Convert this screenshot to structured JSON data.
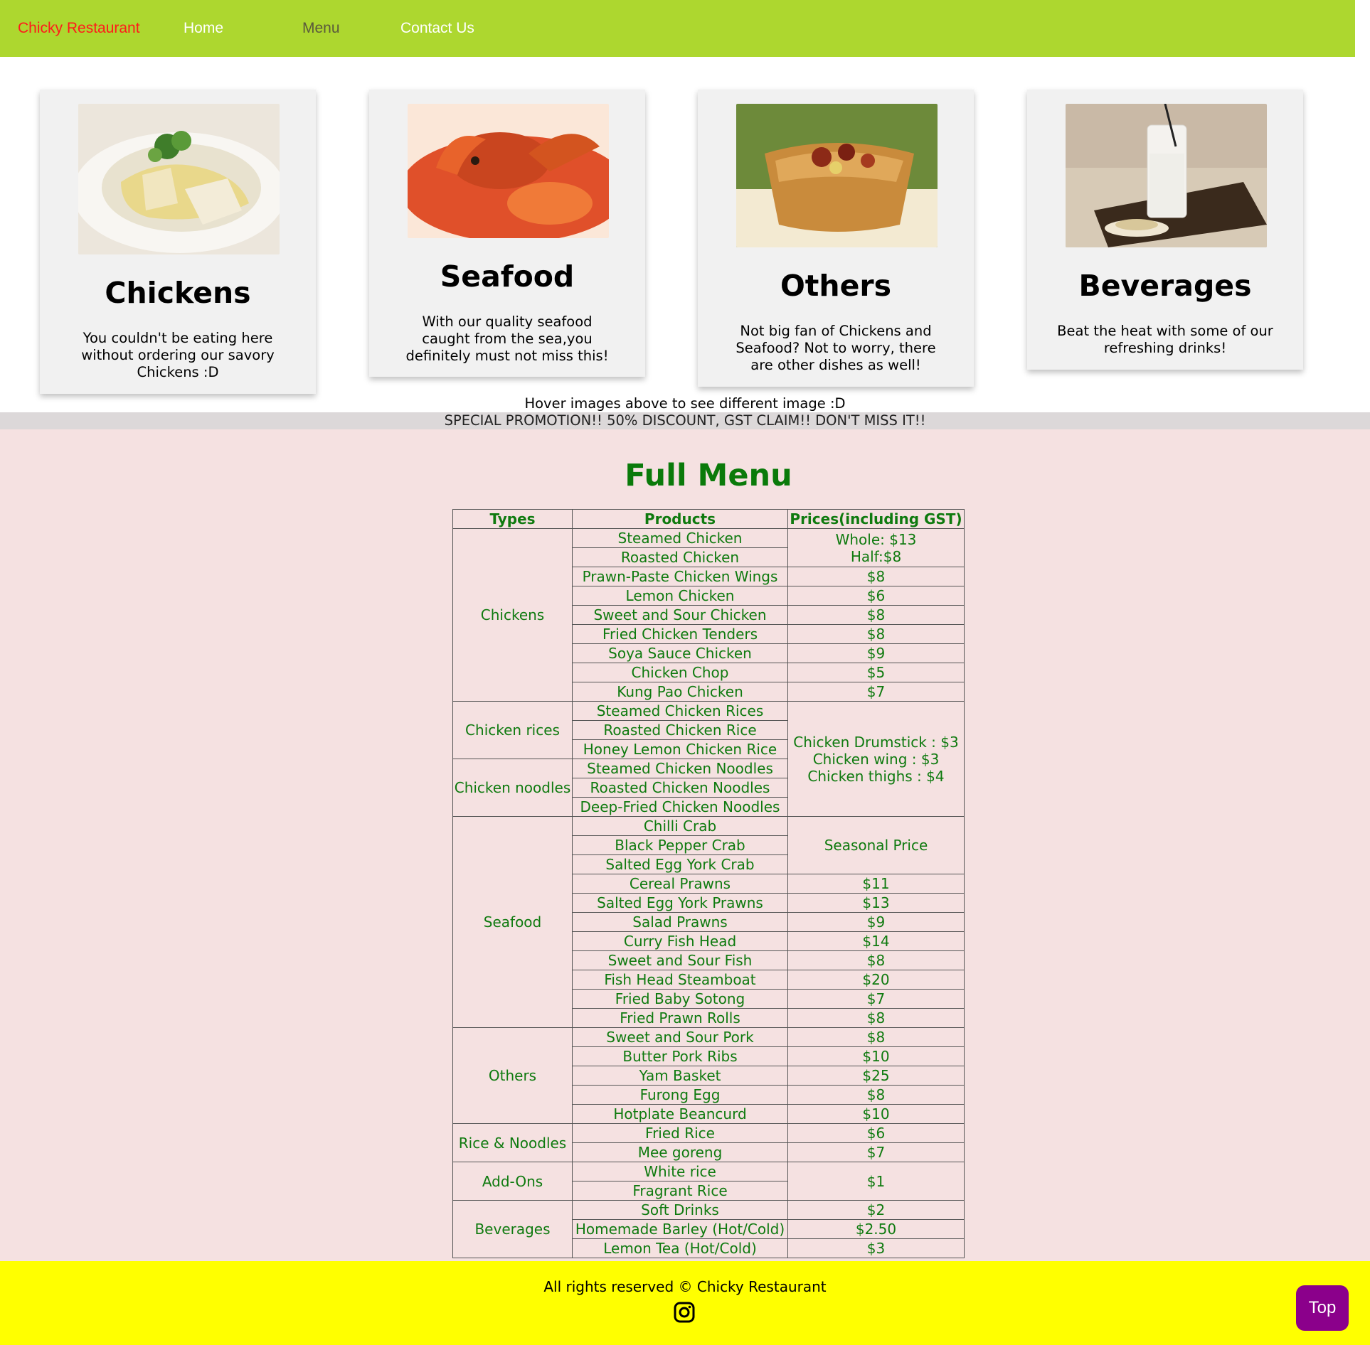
{
  "nav": {
    "brand": "Chicky Restaurant",
    "links": [
      "Home",
      "Menu",
      "Contact Us"
    ],
    "active": "Menu",
    "bg": "#add72f"
  },
  "cards": [
    {
      "title": "Chickens",
      "desc": "You couldn't be eating here without ordering our savory Chickens :D",
      "image": "chicken-dish"
    },
    {
      "title": "Seafood",
      "desc": "With our quality seafood caught from the sea,you definitely must not miss this!",
      "image": "chilli-crab"
    },
    {
      "title": "Others",
      "desc": "Not big fan of Chickens and Seafood? Not to worry, there are other dishes as well!",
      "image": "yam-basket"
    },
    {
      "title": "Beverages",
      "desc": "Beat the heat with some of our refreshing drinks!",
      "image": "barley-drink"
    }
  ],
  "hint": "Hover images above to see different image :D",
  "promo": "SPECIAL PROMOTION!! 50% DISCOUNT, GST CLAIM!! DON'T MISS IT!!",
  "menu": {
    "title": "Full Menu",
    "headers": [
      "Types",
      "Products",
      "Prices(including GST)"
    ],
    "types": [
      "Chickens",
      "Chicken rices",
      "Chicken noodles",
      "Seafood",
      "Others",
      "Rice & Noodles",
      "Add-Ons",
      "Beverages"
    ],
    "products": [
      "Steamed Chicken",
      "Roasted Chicken",
      "Prawn-Paste Chicken Wings",
      "Lemon Chicken",
      "Sweet and Sour Chicken",
      "Fried Chicken Tenders",
      "Soya Sauce Chicken",
      "Chicken Chop",
      "Kung Pao Chicken",
      "Steamed Chicken Rices",
      "Roasted Chicken Rice",
      "Honey Lemon Chicken Rice",
      "Steamed Chicken Noodles",
      "Roasted Chicken Noodles",
      "Deep-Fried Chicken Noodles",
      "Chilli Crab",
      "Black Pepper Crab",
      "Salted Egg York Crab",
      "Cereal Prawns",
      "Salted Egg York Prawns",
      "Salad Prawns",
      "Curry Fish Head",
      "Sweet and Sour Fish",
      "Fish Head Steamboat",
      "Fried Baby Sotong",
      "Fried Prawn Rolls",
      "Sweet and Sour Pork",
      "Butter Pork Ribs",
      "Yam Basket",
      "Furong Egg",
      "Hotplate Beancurd",
      "Fried Rice",
      "Mee goreng",
      "White rice",
      "Fragrant Rice",
      "Soft Drinks",
      "Homemade Barley (Hot/Cold)",
      "Lemon Tea (Hot/Cold)"
    ],
    "prices": {
      "chicken_whole": "Whole: $13",
      "chicken_half": "Half:$8",
      "prawn_wings": "$8",
      "lemon": "$6",
      "sweet_sour_chicken": "$8",
      "tenders": "$8",
      "soya": "$9",
      "chop": "$5",
      "kung_pao": "$7",
      "drumstick": "Chicken Drumstick : $3",
      "wing": "Chicken wing : $3",
      "thighs": "Chicken thighs : $4",
      "seasonal": "Seasonal Price",
      "cereal": "$11",
      "salted_prawns": "$13",
      "salad": "$9",
      "curry": "$14",
      "sweet_sour_fish": "$8",
      "steamboat": "$20",
      "sotong": "$7",
      "rolls": "$8",
      "pork": "$8",
      "ribs": "$10",
      "yam": "$25",
      "furong": "$8",
      "beancurd": "$10",
      "fried_rice": "$6",
      "mee": "$7",
      "addon": "$1",
      "soft": "$2",
      "barley": "$2.50",
      "tea": "$3"
    }
  },
  "footer": {
    "copyright": "All rights reserved © Chicky Restaurant",
    "social_icon": "instagram-icon",
    "bg": "#ffff00"
  },
  "top_button": "Top"
}
